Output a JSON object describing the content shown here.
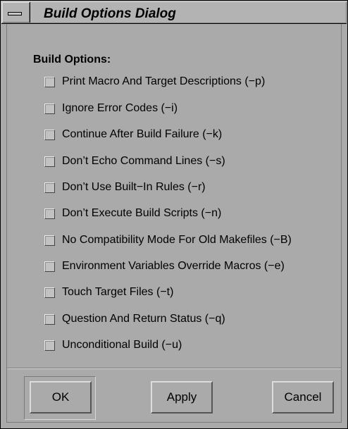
{
  "window": {
    "title": "Build Options Dialog"
  },
  "section": {
    "label": "Build Options:"
  },
  "options": [
    {
      "label": "Print Macro And Target Descriptions (−p)",
      "checked": false
    },
    {
      "label": "Ignore Error Codes (−i)",
      "checked": false
    },
    {
      "label": "Continue After Build Failure (−k)",
      "checked": false
    },
    {
      "label": "Don’t Echo Command Lines (−s)",
      "checked": false
    },
    {
      "label": "Don’t Use Built−In Rules (−r)",
      "checked": false
    },
    {
      "label": "Don’t Execute Build Scripts (−n)",
      "checked": false
    },
    {
      "label": "No Compatibility Mode For Old Makefiles (−B)",
      "checked": false
    },
    {
      "label": "Environment Variables Override Macros (−e)",
      "checked": false
    },
    {
      "label": "Touch Target Files (−t)",
      "checked": false
    },
    {
      "label": "Question And Return Status (−q)",
      "checked": false
    },
    {
      "label": "Unconditional Build (−u)",
      "checked": false
    }
  ],
  "buttons": {
    "ok": "OK",
    "apply": "Apply",
    "cancel": "Cancel"
  },
  "icons": {
    "window_menu": "window-menu-icon"
  },
  "colors": {
    "background": "#aaaaaa",
    "text": "#000000"
  }
}
